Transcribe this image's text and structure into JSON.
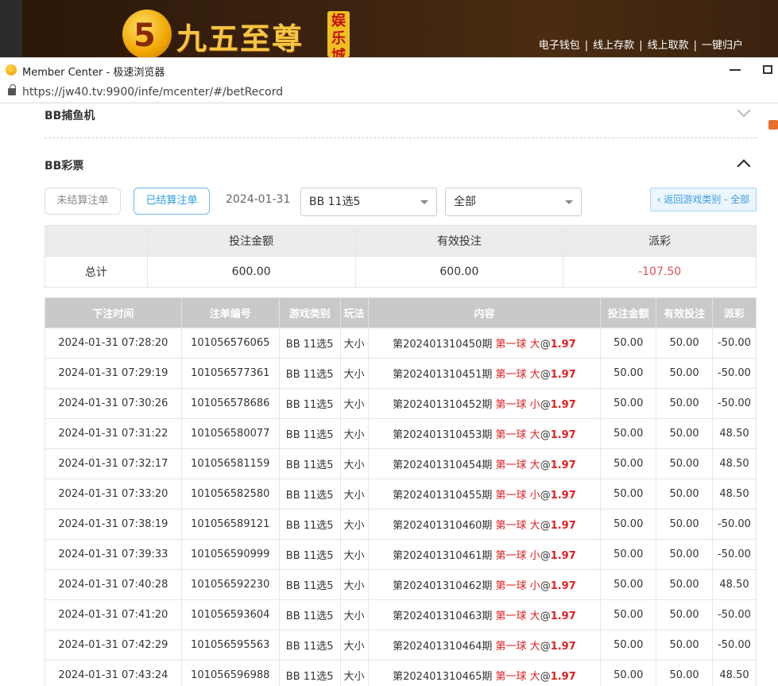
{
  "site": {
    "logo_digit": "5",
    "logo_text": "九五至尊",
    "logo_sub": "娱乐城",
    "top_links": [
      "电子钱包",
      "线上存款",
      "线上取款",
      "一键归户"
    ]
  },
  "browser": {
    "window_title": "Member Center - 极速浏览器",
    "url": "https://jw40.tv:9900/infe/mcenter/#/betRecord"
  },
  "sections": {
    "prev_title": "BB捕鱼机",
    "current_title": "BB彩票"
  },
  "filters": {
    "unsettled_label": "未结算注单",
    "settled_label": "已结算注单",
    "date": "2024-01-31",
    "game_select": "BB 11选5",
    "type_select": "全部",
    "back_label": "‹ 返回游戏类别 - 全部"
  },
  "summary": {
    "headers": [
      "",
      "投注金额",
      "有效投注",
      "派彩"
    ],
    "label": "总计",
    "bet_amount": "600.00",
    "valid_bet": "600.00",
    "payout": "-107.50"
  },
  "records": {
    "headers": [
      "下注时间",
      "注单编号",
      "游戏类别",
      "玩法",
      "内容",
      "投注金额",
      "有效投注",
      "派彩"
    ],
    "rows": [
      {
        "time": "2024-01-31 07:28:20",
        "id": "101056576065",
        "game": "BB 11选5",
        "play": "大小",
        "period": "第202401310450期",
        "pick": "第一球 大",
        "odds": "1.97",
        "bet": "50.00",
        "valid": "50.00",
        "payout": "-50.00"
      },
      {
        "time": "2024-01-31 07:29:19",
        "id": "101056577361",
        "game": "BB 11选5",
        "play": "大小",
        "period": "第202401310451期",
        "pick": "第一球 大",
        "odds": "1.97",
        "bet": "50.00",
        "valid": "50.00",
        "payout": "-50.00"
      },
      {
        "time": "2024-01-31 07:30:26",
        "id": "101056578686",
        "game": "BB 11选5",
        "play": "大小",
        "period": "第202401310452期",
        "pick": "第一球 小",
        "odds": "1.97",
        "bet": "50.00",
        "valid": "50.00",
        "payout": "-50.00"
      },
      {
        "time": "2024-01-31 07:31:22",
        "id": "101056580077",
        "game": "BB 11选5",
        "play": "大小",
        "period": "第202401310453期",
        "pick": "第一球 大",
        "odds": "1.97",
        "bet": "50.00",
        "valid": "50.00",
        "payout": "48.50"
      },
      {
        "time": "2024-01-31 07:32:17",
        "id": "101056581159",
        "game": "BB 11选5",
        "play": "大小",
        "period": "第202401310454期",
        "pick": "第一球 大",
        "odds": "1.97",
        "bet": "50.00",
        "valid": "50.00",
        "payout": "48.50"
      },
      {
        "time": "2024-01-31 07:33:20",
        "id": "101056582580",
        "game": "BB 11选5",
        "play": "大小",
        "period": "第202401310455期",
        "pick": "第一球 小",
        "odds": "1.97",
        "bet": "50.00",
        "valid": "50.00",
        "payout": "48.50"
      },
      {
        "time": "2024-01-31 07:38:19",
        "id": "101056589121",
        "game": "BB 11选5",
        "play": "大小",
        "period": "第202401310460期",
        "pick": "第一球 大",
        "odds": "1.97",
        "bet": "50.00",
        "valid": "50.00",
        "payout": "-50.00"
      },
      {
        "time": "2024-01-31 07:39:33",
        "id": "101056590999",
        "game": "BB 11选5",
        "play": "大小",
        "period": "第202401310461期",
        "pick": "第一球 小",
        "odds": "1.97",
        "bet": "50.00",
        "valid": "50.00",
        "payout": "-50.00"
      },
      {
        "time": "2024-01-31 07:40:28",
        "id": "101056592230",
        "game": "BB 11选5",
        "play": "大小",
        "period": "第202401310462期",
        "pick": "第一球 小",
        "odds": "1.97",
        "bet": "50.00",
        "valid": "50.00",
        "payout": "48.50"
      },
      {
        "time": "2024-01-31 07:41:20",
        "id": "101056593604",
        "game": "BB 11选5",
        "play": "大小",
        "period": "第202401310463期",
        "pick": "第一球 大",
        "odds": "1.97",
        "bet": "50.00",
        "valid": "50.00",
        "payout": "-50.00"
      },
      {
        "time": "2024-01-31 07:42:29",
        "id": "101056595563",
        "game": "BB 11选5",
        "play": "大小",
        "period": "第202401310464期",
        "pick": "第一球 大",
        "odds": "1.97",
        "bet": "50.00",
        "valid": "50.00",
        "payout": "-50.00"
      },
      {
        "time": "2024-01-31 07:43:24",
        "id": "101056596988",
        "game": "BB 11选5",
        "play": "大小",
        "period": "第202401310465期",
        "pick": "第一球 大",
        "odds": "1.97",
        "bet": "50.00",
        "valid": "50.00",
        "payout": "48.50"
      }
    ]
  },
  "colors": {
    "negative": "#e0505a",
    "pick": "#e02020",
    "accent": "#2e9fe0"
  }
}
